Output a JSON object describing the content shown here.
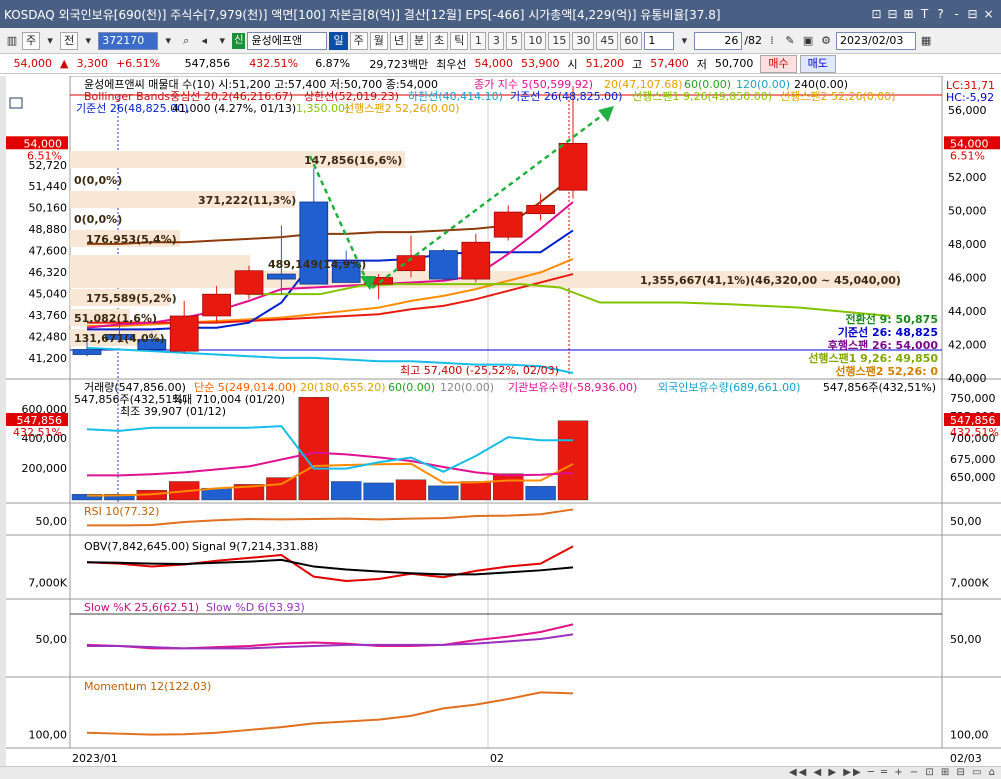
{
  "window": {
    "title": "KOSDAQ 외국인보유[690(천)] 주식수[7,979(천)] 액면[100] 자본금[8(억)] 결산[12월] EPS[-466] 시가총액[4,229(억)] 유통비율[37.8]",
    "controls": [
      "⊡",
      "⊟",
      "⊞",
      "T",
      "?",
      "-",
      "⊟",
      "×"
    ]
  },
  "toolbar": {
    "menu_main": "주",
    "menu_all": "전",
    "code_value": "372170",
    "new_tag": "신",
    "stock_name": "윤성에프앤",
    "periods": [
      "일",
      "주",
      "월",
      "년",
      "분",
      "초",
      "틱"
    ],
    "selected_period": "일",
    "intervals": [
      "1",
      "3",
      "5",
      "10",
      "15",
      "30",
      "45",
      "60"
    ],
    "interval_value": "1",
    "count_value": "26",
    "count_total": "/82",
    "date_value": "2023/02/03"
  },
  "quote": {
    "price": "54,000",
    "arrow": "▲",
    "change": "3,300",
    "change_pct": "+6.51%",
    "volume": "547,856",
    "volume_ratio": "432.51%",
    "turnover": "6.87%",
    "amount": "29,723백만",
    "best_label": "최우선",
    "best_ask": "54,000",
    "best_bid": "53,900",
    "open_label": "시",
    "open": "51,200",
    "high_label": "고",
    "high": "57,400",
    "low_label": "저",
    "low": "50,700",
    "buy_label": "매수",
    "sell_label": "매도"
  },
  "colors": {
    "up": "#e8190e",
    "down": "#1f5fd0",
    "lc_red": "#e00000",
    "hc_blue": "#0000d0",
    "bb_upper": "#8b3a0a",
    "bb_mid": "#ff8c00",
    "pivot": "#0022cc",
    "conv": "#e01090",
    "span1": "#82c400",
    "base_cyan": "#16bde6"
  },
  "chart_data": [
    {
      "type": "candlestick",
      "panel": "price",
      "title": "윤성에프앤씨 매물대 수(10) 시:51,200 고:57,400 저:50,700 종:54,000",
      "x_labels": [
        "2023/01",
        "02"
      ],
      "ylim": [
        40000,
        57000
      ],
      "y_ticks": [
        52720,
        51440,
        50160,
        48880,
        47600,
        46320,
        45040,
        43760,
        42480,
        41200
      ],
      "y_ticks_right": [
        56000,
        54000,
        52000,
        50000,
        48000,
        46000,
        44000,
        42000,
        40000
      ],
      "legend": {
        "close_ma5": "종가 지수 5(50,599.92)",
        "ma20": "20(47,107.68)",
        "ma60": "60(0.00)",
        "ma120": "120(0.00)",
        "ma240": "240(0.00)",
        "bollinger": "Bollinger Bands중심선 20,2(46,216.67)",
        "upper": "상한선(52,019.23)",
        "lower": "하한선(40,414.10)",
        "base26": "기준선 26(48,825.00)",
        "span1": "선행스팬1 9,26(49,850.00)",
        "span2": "선행스팬2 52,26(0.00)",
        "conv26": "기준선 26(48,825.00)",
        "gap_label": "41,000 (4.27%, 01/13)",
        "span1_b": "1,350.00)",
        "span2_b": "선행스팬2 52,26(0.00)"
      },
      "candles": [
        {
          "o": 41700,
          "h": 42200,
          "l": 41300,
          "c": 41400
        },
        {
          "o": 42600,
          "h": 43200,
          "l": 42100,
          "c": 42300
        },
        {
          "o": 42300,
          "h": 42700,
          "l": 41600,
          "c": 41700
        },
        {
          "o": 41600,
          "h": 44600,
          "l": 41500,
          "c": 43700
        },
        {
          "o": 43700,
          "h": 45500,
          "l": 43300,
          "c": 45000
        },
        {
          "o": 45000,
          "h": 46700,
          "l": 44700,
          "c": 46400
        },
        {
          "o": 46200,
          "h": 49100,
          "l": 45000,
          "c": 45900
        },
        {
          "o": 50500,
          "h": 52500,
          "l": 45600,
          "c": 45600
        },
        {
          "o": 46900,
          "h": 47600,
          "l": 45700,
          "c": 45700
        },
        {
          "o": 45600,
          "h": 46200,
          "l": 44700,
          "c": 46000
        },
        {
          "o": 46400,
          "h": 48500,
          "l": 46000,
          "c": 47300
        },
        {
          "o": 47600,
          "h": 47700,
          "l": 45800,
          "c": 45900
        },
        {
          "o": 45900,
          "h": 48600,
          "l": 45700,
          "c": 48100
        },
        {
          "o": 48400,
          "h": 50300,
          "l": 48200,
          "c": 49900
        },
        {
          "o": 49800,
          "h": 51000,
          "l": 49400,
          "c": 50300
        },
        {
          "o": 51200,
          "h": 57400,
          "l": 50700,
          "c": 54000
        }
      ],
      "lines": {
        "bb_upper": [
          48000,
          48000,
          48100,
          48100,
          48200,
          48300,
          48400,
          48600,
          48600,
          48700,
          48700,
          48800,
          48900,
          49100,
          50500,
          52000
        ],
        "conv": [
          43000,
          43200,
          43300,
          43600,
          44000,
          44600,
          45300,
          45400,
          45500,
          45600,
          45700,
          45800,
          46100,
          47400,
          48900,
          50500
        ],
        "pivot": [
          42900,
          42900,
          42900,
          43000,
          43000,
          43300,
          44500,
          47000,
          47000,
          47000,
          47100,
          47400,
          47500,
          47500,
          47500,
          48800
        ],
        "ma20": [
          43100,
          43100,
          43200,
          43300,
          43400,
          43500,
          43600,
          43800,
          44000,
          44200,
          44600,
          44900,
          45300,
          45800,
          46300,
          47100
        ],
        "bb_mid": [
          43300,
          43300,
          43300,
          43300,
          43300,
          43400,
          43500,
          43600,
          43700,
          43800,
          44100,
          44300,
          44700,
          45200,
          45700,
          46200
        ],
        "span1": [
          45000,
          45000,
          45000,
          45500,
          45600,
          45600,
          45600,
          45400,
          44500,
          44500,
          44400,
          44200,
          43700
        ],
        "base_cyan": [
          41800,
          41700,
          41600,
          41500,
          41400,
          41300,
          41200,
          41200,
          41100,
          41000,
          41000,
          40900,
          40800,
          40800,
          40700,
          40300
        ]
      },
      "volume_profile": [
        {
          "label": "147,856(16,6%)",
          "value_label": ""
        },
        {
          "label": "0(0,0%)",
          "value_label": ""
        },
        {
          "label": "371,222(11,3%)",
          "value_label": ""
        },
        {
          "label": "0(0,0%)",
          "value_label": ""
        },
        {
          "label": "176,953(5,4%)",
          "value_label": ""
        },
        {
          "label": "489,149(14,9%)",
          "value_label": ""
        },
        {
          "label": "1,355,667(41,1%)(46,320,00 ~ 45,040,00)",
          "value_label": ""
        },
        {
          "label": "175,589(5,2%)",
          "value_label": ""
        },
        {
          "label": "51,082(1,6%)",
          "value_label": ""
        },
        {
          "label": "131,671(4,0%)",
          "value_label": ""
        }
      ],
      "annotations": {
        "high_note": "최고 57,400 (-25,52%, 02/03)",
        "lc": "LC:31,71",
        "hc": "HC:-5,92",
        "last_price": "54,000",
        "last_pct": "6.51%"
      },
      "right_legend": [
        {
          "label": "전환선 9: 50,875",
          "color": "#1a8a1a"
        },
        {
          "label": "기준선 26: 48,825",
          "color": "#0000cc"
        },
        {
          "label": "후행스팬 26: 54,000",
          "color": "#7a0a8a"
        },
        {
          "label": "선행스팬1 9,26: 49,850",
          "color": "#82a800"
        },
        {
          "label": "선행스팬2 52,26: 0",
          "color": "#d08000"
        }
      ]
    },
    {
      "type": "bar",
      "panel": "volume",
      "title_parts": [
        "거래량(547,856.00)",
        "단순 5(249,014.00)",
        "20(180,655.20)",
        "60(0.00)",
        "120(0.00)",
        "기관보유수량(-58,936.00)",
        "외국인보유수량(689,661.00)"
      ],
      "right_note": "547,856주(432,51%)",
      "left_note": "547,856주(432,51%)",
      "max_note": "최대 710,004 (01/20)",
      "min_note": "최조 39,907 (01/12)",
      "y_ticks": [
        "600,000",
        "400,000",
        "200,000"
      ],
      "y_ticks_right": [
        "750,000",
        "725,000",
        "700,000",
        "675,000",
        "650,000"
      ],
      "last_value": "547,856",
      "last_pct": "432,51%",
      "values": [
        40000,
        39907,
        68000,
        128000,
        82000,
        108000,
        155000,
        710004,
        128000,
        118000,
        140000,
        98000,
        128000,
        182000,
        95000,
        547856
      ],
      "up": [
        false,
        false,
        true,
        true,
        false,
        true,
        true,
        true,
        false,
        false,
        true,
        false,
        true,
        true,
        false,
        true
      ],
      "ma5": [
        30000,
        32000,
        40000,
        60000,
        80000,
        92000,
        110000,
        235000,
        242000,
        247000,
        250000,
        120000,
        122000,
        135000,
        135000,
        249014
      ],
      "institution": [
        82000,
        82000,
        86000,
        92000,
        102000,
        112000,
        135000,
        158000,
        152000,
        142000,
        130000,
        110000,
        92000,
        82000,
        84000,
        90000
      ],
      "foreign": [
        710000,
        708000,
        712000,
        712000,
        712000,
        712000,
        714000,
        660000,
        660000,
        668000,
        674000,
        656000,
        676000,
        700000,
        696000,
        696000
      ]
    },
    {
      "type": "line",
      "panel": "rsi",
      "title": "RSI 10(77.32)",
      "y_ticks": [
        "50,00"
      ],
      "values": [
        40,
        40,
        41,
        48,
        52,
        55,
        54,
        55,
        56,
        54,
        56,
        57,
        62,
        63,
        66,
        77.32
      ]
    },
    {
      "type": "line",
      "panel": "obv",
      "title": "OBV(7,842,645.00)",
      "signal_title": "Signal 9(7,214,331.88)",
      "y_ticks": [
        "7,000K"
      ],
      "obv": [
        7.7,
        7.65,
        7.55,
        7.62,
        7.75,
        7.85,
        7.95,
        7.2,
        7.05,
        7.12,
        7.3,
        7.18,
        7.4,
        7.55,
        7.65,
        8.25
      ],
      "signal": [
        7.7,
        7.68,
        7.65,
        7.64,
        7.68,
        7.72,
        7.78,
        7.55,
        7.45,
        7.38,
        7.32,
        7.28,
        7.28,
        7.35,
        7.42,
        7.52
      ]
    },
    {
      "type": "line",
      "panel": "stochastic",
      "title_k": "Slow %K 25,6(62.51)",
      "title_d": "Slow %D 6(53.93)",
      "y_ticks": [
        "50,00"
      ],
      "k": [
        45,
        44,
        42,
        42,
        43,
        44,
        46,
        47,
        46,
        44,
        44,
        45,
        49,
        52,
        56,
        62.51
      ],
      "d": [
        44,
        44,
        43,
        42,
        42,
        42,
        43,
        44,
        45,
        45,
        45,
        45,
        46,
        48,
        50,
        53.93
      ]
    },
    {
      "type": "line",
      "panel": "momentum",
      "title": "Momentum 12(122.03)",
      "y_ticks": [
        "100,00"
      ],
      "values": [
        101,
        100.5,
        100,
        100.2,
        101,
        102.5,
        104,
        106,
        107,
        108,
        110,
        114,
        116,
        119,
        122.5,
        122.03
      ]
    }
  ],
  "axes": {
    "date_left": "2023/01",
    "date_mid": "02",
    "date_right": "02/03"
  },
  "bottombar": {
    "controls": "◀◀ ◀ ▶ ▶▶ ─ ═ + − ⊡ ⊞ ⊟ ▭ ⌂"
  }
}
